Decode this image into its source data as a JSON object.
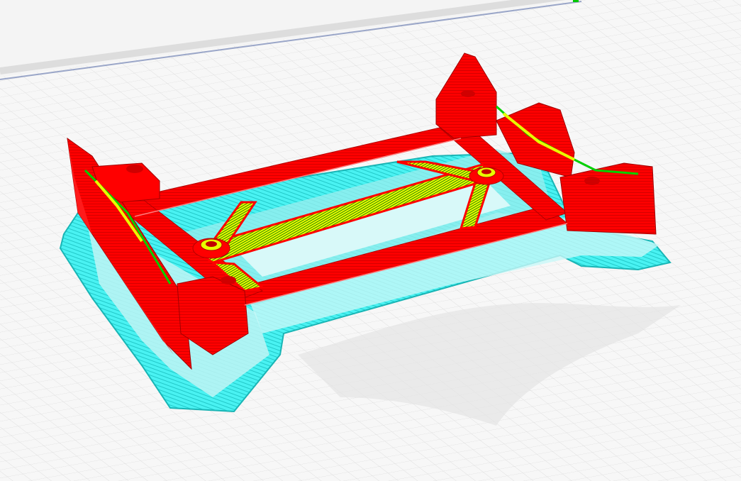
{
  "app": {
    "view": "layer-preview-3d"
  },
  "colors": {
    "background": "#f2f2f2",
    "build_plate": "#f7f7f7",
    "grid_minor": "#dcdcdc",
    "grid_major": "#c8c8c8",
    "plate_edge": "#9aa6c8",
    "wall": "#ff0000",
    "infill": "#e8ff00",
    "skin": "#00d000",
    "support": "#49f2f2",
    "support_interface": "#b9f6f6",
    "travel_shadow": "#cfcfcf"
  },
  "legend_items": [
    "wall",
    "infill",
    "skin",
    "support"
  ]
}
